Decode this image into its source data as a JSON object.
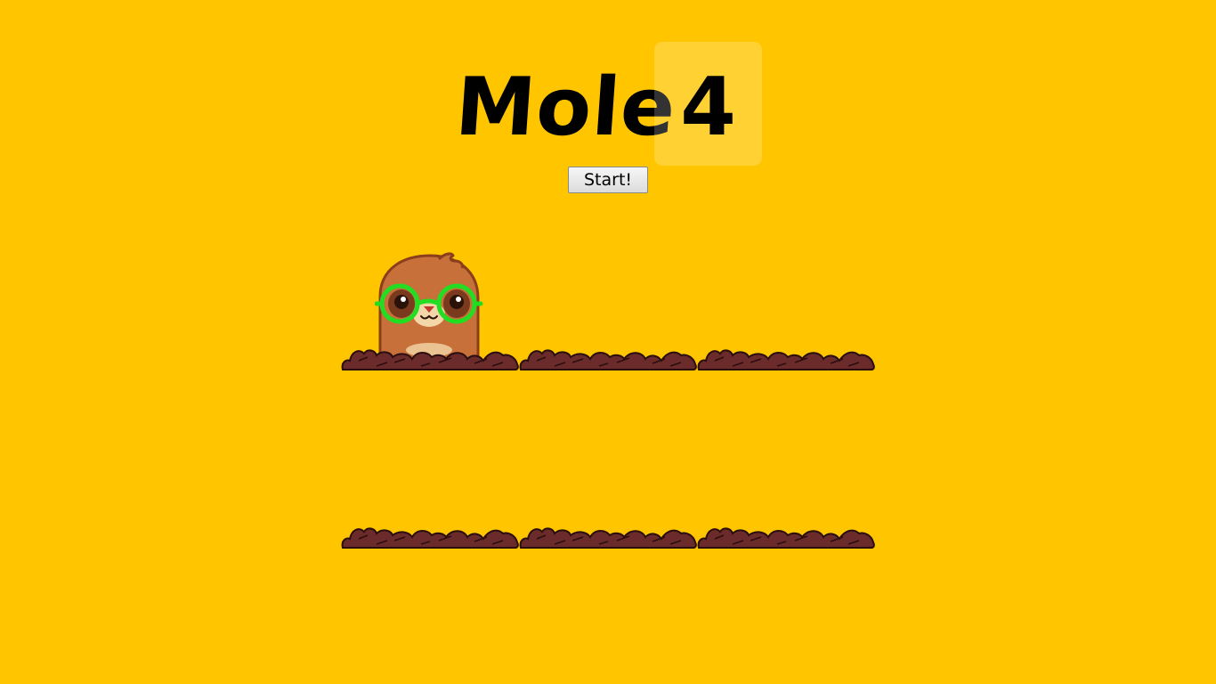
{
  "title": {
    "word": "Mole",
    "score": "4"
  },
  "controls": {
    "start_label": "Start!"
  },
  "board": {
    "rows": 2,
    "columns": 3,
    "active_hole": 1
  },
  "colors": {
    "background": "#FFC600",
    "dirt": "#6B2B2B",
    "mole_fur": "#C8703A",
    "glasses": "#22DD22"
  }
}
